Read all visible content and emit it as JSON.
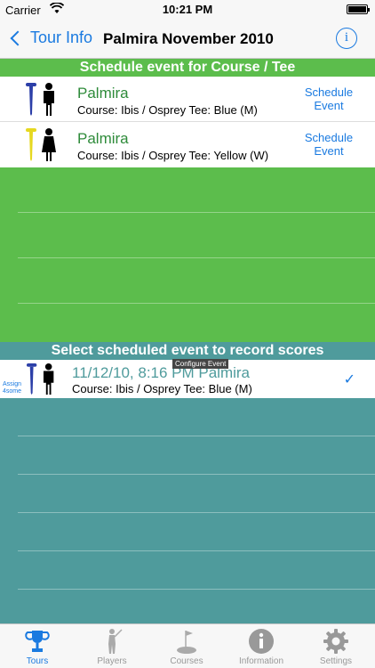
{
  "status_bar": {
    "carrier": "Carrier",
    "time": "10:21 PM"
  },
  "nav": {
    "back_label": "Tour Info",
    "title": "Palmira November 2010",
    "info_glyph": "i"
  },
  "schedule_section": {
    "header": "Schedule event for Course / Tee",
    "rows": [
      {
        "name": "Palmira",
        "course": "Course: Ibis / Osprey Tee: Blue (M)",
        "action": "Schedule Event",
        "tee_color": "#2c3fa8",
        "gender": "male"
      },
      {
        "name": "Palmira",
        "course": "Course: Ibis / Osprey Tee: Yellow (W)",
        "action": "Schedule Event",
        "tee_color": "#e6d820",
        "gender": "female"
      }
    ]
  },
  "scores_section": {
    "header": "Select scheduled event to record scores",
    "rows": [
      {
        "assign": "Assign 4some",
        "name": "11/12/10, 8:16 PM Palmira",
        "course": "Course: Ibis / Osprey Tee: Blue (M)",
        "tooltip": "Configure Event",
        "check": "✓",
        "tee_color": "#2c3fa8"
      }
    ]
  },
  "tabs": [
    {
      "label": "Tours",
      "icon": "trophy-icon",
      "active": true
    },
    {
      "label": "Players",
      "icon": "golfer-icon",
      "active": false
    },
    {
      "label": "Courses",
      "icon": "flag-icon",
      "active": false
    },
    {
      "label": "Information",
      "icon": "info-icon",
      "active": false
    },
    {
      "label": "Settings",
      "icon": "gear-icon",
      "active": false
    }
  ],
  "colors": {
    "green": "#5cbd4c",
    "teal": "#4f9b9c",
    "accent": "#1a7ae0",
    "name_green": "#2e8b3a"
  }
}
